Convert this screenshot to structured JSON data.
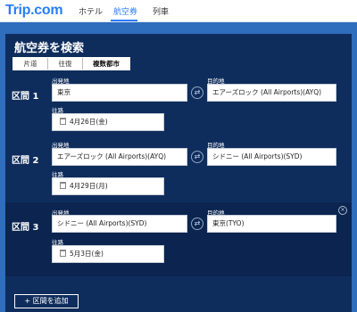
{
  "header": {
    "logo": "Trip.com",
    "nav": [
      {
        "label": "ホテル"
      },
      {
        "label": "航空券"
      },
      {
        "label": "列車"
      }
    ]
  },
  "search": {
    "title": "航空券を検索",
    "trip_types": [
      "片道",
      "往復",
      "複数都市"
    ],
    "selected_trip_type": "複数都市",
    "from_label": "出発地",
    "to_label": "目的地",
    "date_label": "往路",
    "segments": [
      {
        "label": "区間 1",
        "from": "東京",
        "to": "エアーズロック (All Airports)(AYQ)",
        "date": "4月26日(金)"
      },
      {
        "label": "区間 2",
        "from": "エアーズロック (All Airports)(AYQ)",
        "to": "シドニー (All Airports)(SYD)",
        "date": "4月29日(月)"
      },
      {
        "label": "区間 3",
        "from": "シドニー (All Airports)(SYD)",
        "to": "東京(TYO)",
        "date": "5月3日(金)"
      }
    ],
    "add_segment_label": "+ 区間を追加"
  },
  "colors": {
    "brand": "#287dfa",
    "panel": "#0f2d5c"
  }
}
